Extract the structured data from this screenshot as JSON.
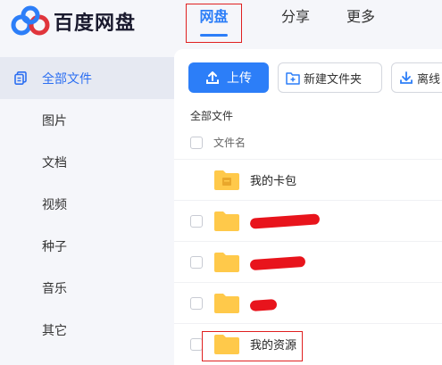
{
  "app": {
    "title": "百度网盘"
  },
  "nav": [
    {
      "label": "网盘",
      "active": true
    },
    {
      "label": "分享",
      "active": false
    },
    {
      "label": "更多",
      "active": false
    }
  ],
  "sidebar": {
    "items": [
      {
        "label": "全部文件",
        "active": true,
        "icon": "files-icon"
      },
      {
        "label": "图片",
        "active": false
      },
      {
        "label": "文档",
        "active": false
      },
      {
        "label": "视频",
        "active": false
      },
      {
        "label": "种子",
        "active": false
      },
      {
        "label": "音乐",
        "active": false
      },
      {
        "label": "其它",
        "active": false
      }
    ]
  },
  "toolbar": {
    "upload_label": "上传",
    "new_folder_label": "新建文件夹",
    "offline_label": "离线"
  },
  "breadcrumb": "全部文件",
  "list": {
    "column_name": "文件名",
    "rows": [
      {
        "name": "我的卡包",
        "type": "card-folder",
        "redacted": false
      },
      {
        "name": "",
        "type": "folder",
        "redacted": true
      },
      {
        "name": "",
        "type": "folder",
        "redacted": true
      },
      {
        "name": "",
        "type": "folder",
        "redacted": true
      },
      {
        "name": "我的资源",
        "type": "folder",
        "redacted": false,
        "highlighted": true
      }
    ]
  },
  "colors": {
    "accent": "#2c7ef8",
    "folder": "#ffc94a",
    "highlight": "#e02020"
  }
}
